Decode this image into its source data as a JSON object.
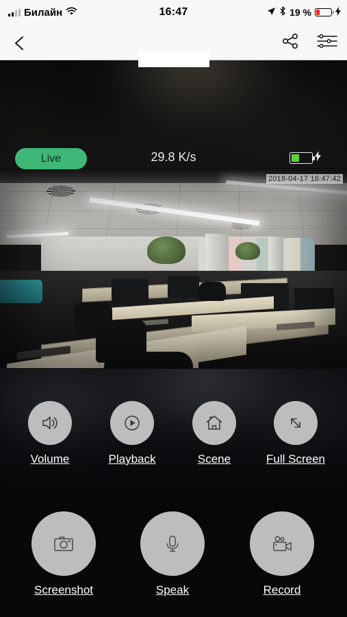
{
  "status_bar": {
    "carrier": "Билайн",
    "wifi_icon": "wifi-icon",
    "time": "16:47",
    "location_icon": "location-arrow-icon",
    "bluetooth_icon": "bluetooth-icon",
    "battery_percent": "19 %",
    "battery_icon": "battery-low-icon",
    "charging_icon": "lightning-bolt-icon",
    "battery_color": "#f2261d"
  },
  "nav_bar": {
    "back_icon": "chevron-left-icon",
    "title": "",
    "title_redacted": true,
    "share_icon": "share-icon",
    "settings_icon": "settings-sliders-icon"
  },
  "player": {
    "live_label": "Live",
    "live_color": "#3fb877",
    "bitrate": "29.8 K/s",
    "camera_battery_icon": "battery-icon",
    "camera_battery_level": "38%",
    "camera_charging_icon": "lightning-bolt-icon",
    "timestamp": "2018-04-17 16:47:42"
  },
  "controls": {
    "row1": [
      {
        "label": "Volume",
        "icon": "speaker-volume-icon"
      },
      {
        "label": "Playback",
        "icon": "play-circle-icon"
      },
      {
        "label": "Scene",
        "icon": "home-icon"
      },
      {
        "label": "Full Screen",
        "icon": "expand-arrows-icon"
      }
    ],
    "row2": [
      {
        "label": "Screenshot",
        "icon": "camera-icon"
      },
      {
        "label": "Speak",
        "icon": "microphone-icon"
      },
      {
        "label": "Record",
        "icon": "video-camera-icon"
      }
    ]
  }
}
